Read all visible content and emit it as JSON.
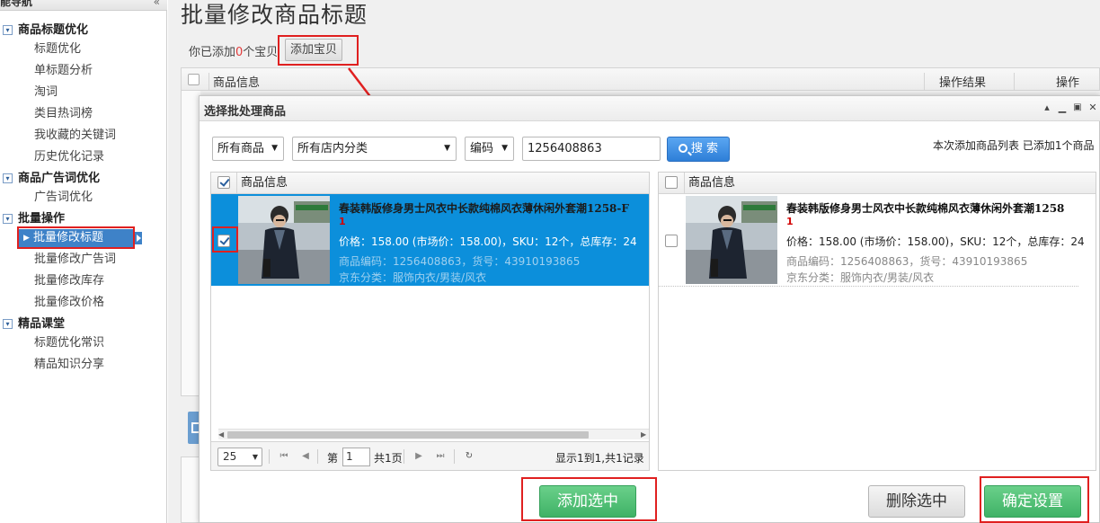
{
  "sidebar": {
    "header": "功能导航",
    "collapse_icon": "«",
    "groups": [
      {
        "label": "商品标题优化",
        "items": [
          "标题优化",
          "单标题分析",
          "淘词",
          "类目热词榜",
          "我收藏的关键词",
          "历史优化记录"
        ]
      },
      {
        "label": "商品广告词优化",
        "items": [
          "广告词优化"
        ]
      },
      {
        "label": "批量操作",
        "items": [
          "批量修改标题",
          "批量修改广告词",
          "批量修改库存",
          "批量修改价格"
        ]
      },
      {
        "label": "精品课堂",
        "items": [
          "标题优化常识",
          "精品知识分享"
        ]
      }
    ],
    "active_item": "批量修改标题"
  },
  "main": {
    "title": "批量修改商品标题",
    "added_prefix": "你已添加",
    "added_count": "0",
    "added_suffix": "个宝贝",
    "add_button": "添加宝贝",
    "table_headers": [
      "商品信息",
      "操作结果",
      "操作"
    ]
  },
  "dialog": {
    "title": "选择批处理商品",
    "controls": [
      "collapse-icon",
      "minimize-icon",
      "maximize-icon",
      "close-icon"
    ],
    "filters": {
      "product_scope": "所有商品",
      "store_category": "所有店内分类",
      "field": "编码",
      "keyword": "1256408863"
    },
    "search_label": "搜 索",
    "right_summary": "本次添加商品列表 已添加1个商品",
    "left_panel": {
      "header": "商品信息",
      "rows": [
        {
          "title": "春装韩版修身男士风衣中长款纯棉风衣薄休闲外套潮1258-F",
          "remark": "1",
          "price_line": "价格：158.00 (市场价：158.00)，SKU：12个，总库存：24",
          "code_line": "商品编码：1256408863，货号：43910193865",
          "category_line": "京东分类：服饰内衣/男装/风衣",
          "checked": true
        }
      ],
      "pager": {
        "page_size": "25",
        "page_label_prefix": "第",
        "page_value": "1",
        "page_label_suffix": "共1页",
        "summary": "显示1到1,共1记录"
      }
    },
    "right_panel": {
      "header": "商品信息",
      "rows": [
        {
          "title": "春装韩版修身男士风衣中长款纯棉风衣薄休闲外套潮1258",
          "remark": "1",
          "price_line": "价格：158.00 (市场价：158.00)，SKU：12个，总库存：24",
          "code_line": "商品编码：1256408863，货号：43910193865",
          "category_line": "京东分类：服饰内衣/男装/风衣",
          "checked": false
        }
      ]
    },
    "buttons": {
      "add_selected": "添加选中",
      "delete_selected": "删除选中",
      "confirm": "确定设置"
    }
  },
  "colors": {
    "selected_row": "#0c8fdb",
    "highlight_box": "#e02020",
    "green_button": "#3fb266",
    "search_button": "#2e7fd8"
  }
}
